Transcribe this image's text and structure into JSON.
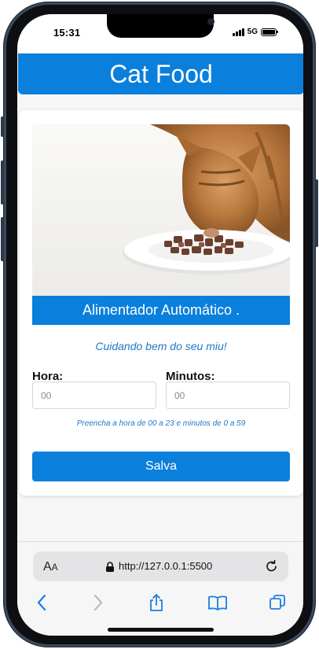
{
  "status_bar": {
    "time": "15:31",
    "network": "5G"
  },
  "app": {
    "title": "Cat Food"
  },
  "card": {
    "banner": "Alimentador Automático .",
    "tagline": "Cuidando bem do seu miu!",
    "hour": {
      "label": "Hora:",
      "placeholder": "00"
    },
    "minutes": {
      "label": "Minutos:",
      "placeholder": "00"
    },
    "hint": "Preencha a hora de 00 a 23 e minutos de 0 a 59",
    "save_label": "Salva"
  },
  "browser": {
    "url": "http://127.0.0.1:5500",
    "text_size_label_big": "A",
    "text_size_label_small": "A"
  },
  "icons": {
    "back": "chevron-left-icon",
    "forward": "chevron-right-icon",
    "share": "share-icon",
    "bookmarks": "book-icon",
    "tabs": "tabs-icon",
    "reload": "reload-icon",
    "lock": "lock-icon"
  },
  "colors": {
    "accent": "#0a7fdc",
    "link_text": "#1f78c8"
  }
}
